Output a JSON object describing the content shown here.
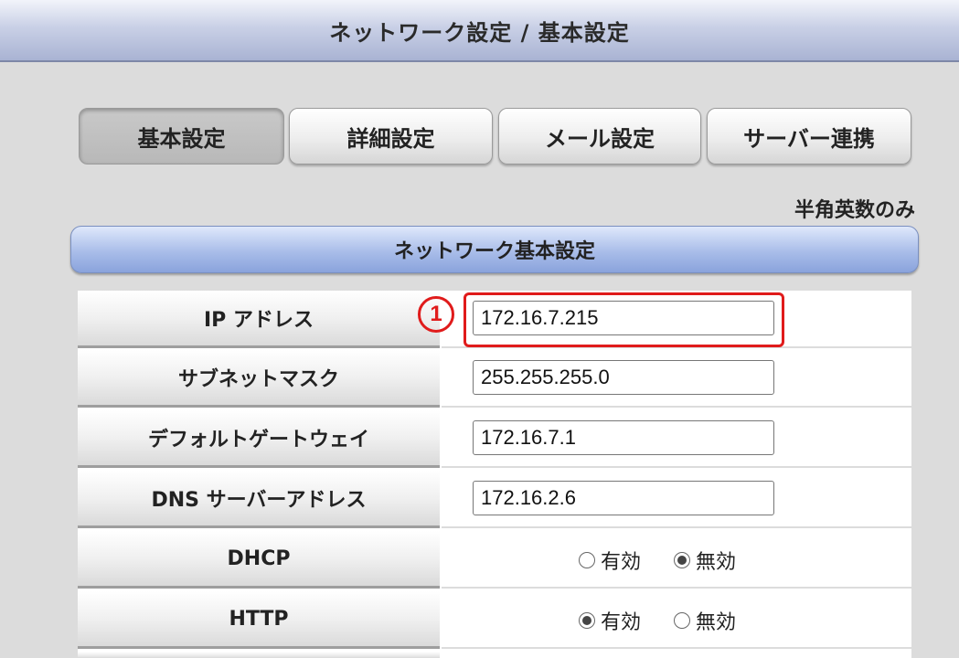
{
  "title": "ネットワーク設定 / 基本設定",
  "tabs": [
    {
      "label": "基本設定",
      "active": true
    },
    {
      "label": "詳細設定",
      "active": false
    },
    {
      "label": "メール設定",
      "active": false
    },
    {
      "label": "サーバー連携",
      "active": false
    }
  ],
  "note": "半角英数のみ",
  "section": {
    "title": "ネットワーク基本設定"
  },
  "fields": {
    "ip": {
      "label": "IP アドレス",
      "value": "172.16.7.215",
      "marker": "1"
    },
    "subnet": {
      "label": "サブネットマスク",
      "value": "255.255.255.0"
    },
    "gateway": {
      "label": "デフォルトゲートウェイ",
      "value": "172.16.7.1"
    },
    "dns": {
      "label": "DNS サーバーアドレス",
      "value": "172.16.2.6"
    }
  },
  "radios": {
    "dhcp": {
      "label": "DHCP",
      "on_label": "有効",
      "off_label": "無効",
      "selected": "off"
    },
    "http": {
      "label": "HTTP",
      "on_label": "有効",
      "off_label": "無効",
      "selected": "on"
    }
  },
  "colors": {
    "highlight": "#e01b1b",
    "section_header": "#a9bde9"
  }
}
